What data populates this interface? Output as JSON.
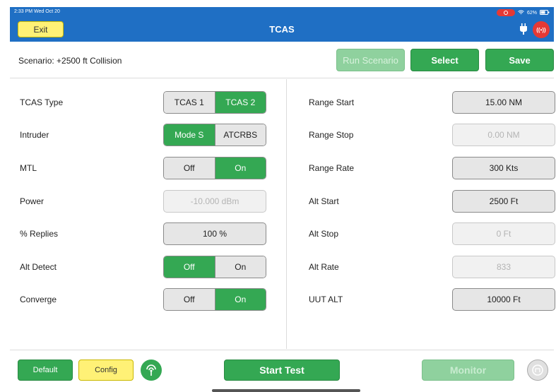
{
  "status": {
    "time": "2:33 PM",
    "date": "Wed Oct 20",
    "battery": "62%"
  },
  "topbar": {
    "exit_label": "Exit",
    "title": "TCAS"
  },
  "scenario": {
    "label": "Scenario: +2500 ft Collision",
    "run_label": "Run Scenario",
    "select_label": "Select",
    "save_label": "Save"
  },
  "left": {
    "tcas_type": {
      "label": "TCAS Type",
      "options": [
        "TCAS 1",
        "TCAS 2"
      ],
      "selected": "TCAS 2"
    },
    "intruder": {
      "label": "Intruder",
      "options": [
        "Mode S",
        "ATCRBS"
      ],
      "selected": "Mode S"
    },
    "mtl": {
      "label": "MTL",
      "options": [
        "Off",
        "On"
      ],
      "selected": "On"
    },
    "power": {
      "label": "Power",
      "value": "-10.000 dBm"
    },
    "replies": {
      "label": "% Replies",
      "value": "100 %"
    },
    "alt_detect": {
      "label": "Alt Detect",
      "options": [
        "Off",
        "On"
      ],
      "selected": "Off"
    },
    "converge": {
      "label": "Converge",
      "options": [
        "Off",
        "On"
      ],
      "selected": "On"
    }
  },
  "right": {
    "range_start": {
      "label": "Range Start",
      "value": "15.00 NM"
    },
    "range_stop": {
      "label": "Range Stop",
      "value": "0.00 NM"
    },
    "range_rate": {
      "label": "Range Rate",
      "value": "300 Kts"
    },
    "alt_start": {
      "label": "Alt Start",
      "value": "2500 Ft"
    },
    "alt_stop": {
      "label": "Alt Stop",
      "value": "0 Ft"
    },
    "alt_rate": {
      "label": "Alt Rate",
      "value": "833"
    },
    "uut_alt": {
      "label": "UUT ALT",
      "value": "10000 Ft"
    }
  },
  "bottom": {
    "default_label": "Default",
    "config_label": "Config",
    "start_label": "Start Test",
    "monitor_label": "Monitor"
  },
  "colors": {
    "header": "#1f6fc4",
    "green": "#34a853",
    "yellow": "#fff176",
    "red": "#e53935"
  }
}
